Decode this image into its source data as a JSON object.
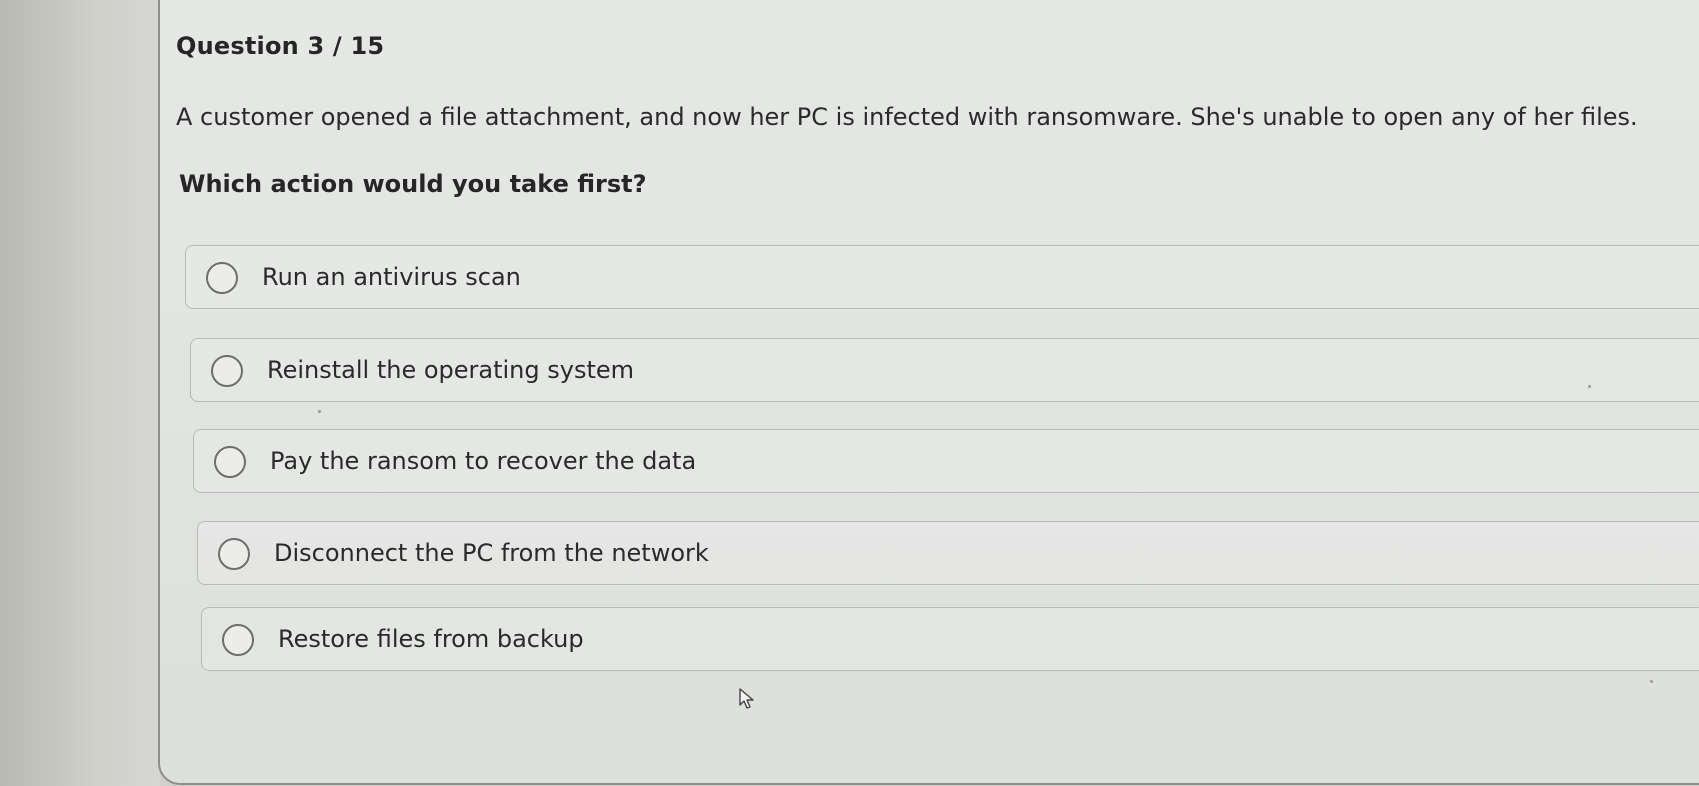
{
  "question": {
    "number_label": "Question 3 / 15",
    "text": "A customer opened a file attachment, and now her PC is infected with ransomware. She's unable to open any of her files.",
    "prompt": "Which action would you take first?"
  },
  "options": [
    {
      "label": "Run an antivirus scan",
      "selected": false
    },
    {
      "label": "Reinstall the operating system",
      "selected": false
    },
    {
      "label": "Pay the ransom to recover the data",
      "selected": false
    },
    {
      "label": "Disconnect the PC from the network",
      "selected": false
    },
    {
      "label": "Restore files from backup",
      "selected": false
    }
  ],
  "icons": {
    "radio": "radio-unchecked-icon",
    "cursor": "mouse-pointer-icon"
  },
  "colors": {
    "panel_background": "#e4e6e4",
    "text": "#2a2a2a",
    "option_border": "#b9bbb8",
    "radio_border": "#6d6f6d"
  }
}
